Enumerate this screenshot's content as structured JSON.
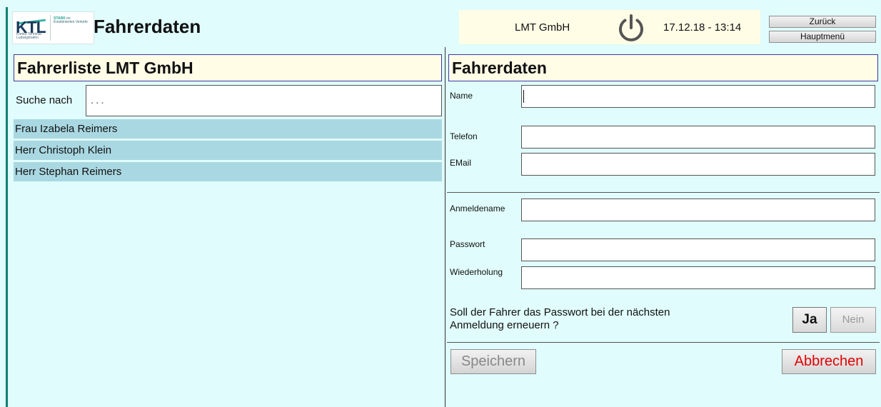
{
  "header": {
    "logo": {
      "mark": "KTL",
      "subtext": "Kombi-Terminal Ludwigshafen",
      "tagline_strong": "STARK",
      "tagline_rest": "im Kombinierten Verkehr"
    },
    "title": "Fahrerdaten",
    "company": "LMT GmbH",
    "datetime": "17.12.18 - 13:14",
    "back_label": "Zurück",
    "main_menu_label": "Hauptmenü"
  },
  "driver_list": {
    "title": "Fahrerliste LMT GmbH",
    "search_label": "Suche nach",
    "search_placeholder": "...",
    "items": [
      {
        "label": "Frau Izabela Reimers"
      },
      {
        "label": "Herr Christoph Klein"
      },
      {
        "label": "Herr Stephan Reimers"
      }
    ]
  },
  "driver_form": {
    "title": "Fahrerdaten",
    "fields": {
      "name": {
        "label": "Name",
        "value": ""
      },
      "phone": {
        "label": "Telefon",
        "value": ""
      },
      "email": {
        "label": "EMail",
        "value": ""
      },
      "username": {
        "label": "Anmeldename",
        "value": ""
      },
      "password": {
        "label": "Passwort",
        "value": ""
      },
      "password_repeat": {
        "label": "Wiederholung",
        "value": ""
      }
    },
    "renew_question": "Soll der Fahrer das Passwort bei der nächsten Anmeldung erneuern ?",
    "yes_label": "Ja",
    "no_label": "Nein",
    "save_label": "Speichern",
    "cancel_label": "Abbrechen"
  },
  "colors": {
    "background": "#e0fcfc",
    "highlight": "#fffde6",
    "list_item": "#a9d8e2",
    "cancel_text": "#e40000",
    "accent_bar": "#0e7f72"
  },
  "icons": {
    "power": "power-icon"
  }
}
